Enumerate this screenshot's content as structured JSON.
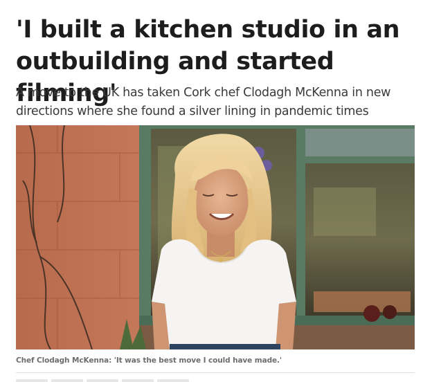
{
  "article": {
    "headline": "'I built a kitchen studio in an outbuilding and started filming'",
    "standfirst": "A move to the UK has taken Cork chef Clodagh McKenna in new directions where she found a silver lining in pandemic times",
    "image": {
      "caption": "Chef Clodagh McKenna: 'It was the best move I could have made.'"
    }
  }
}
